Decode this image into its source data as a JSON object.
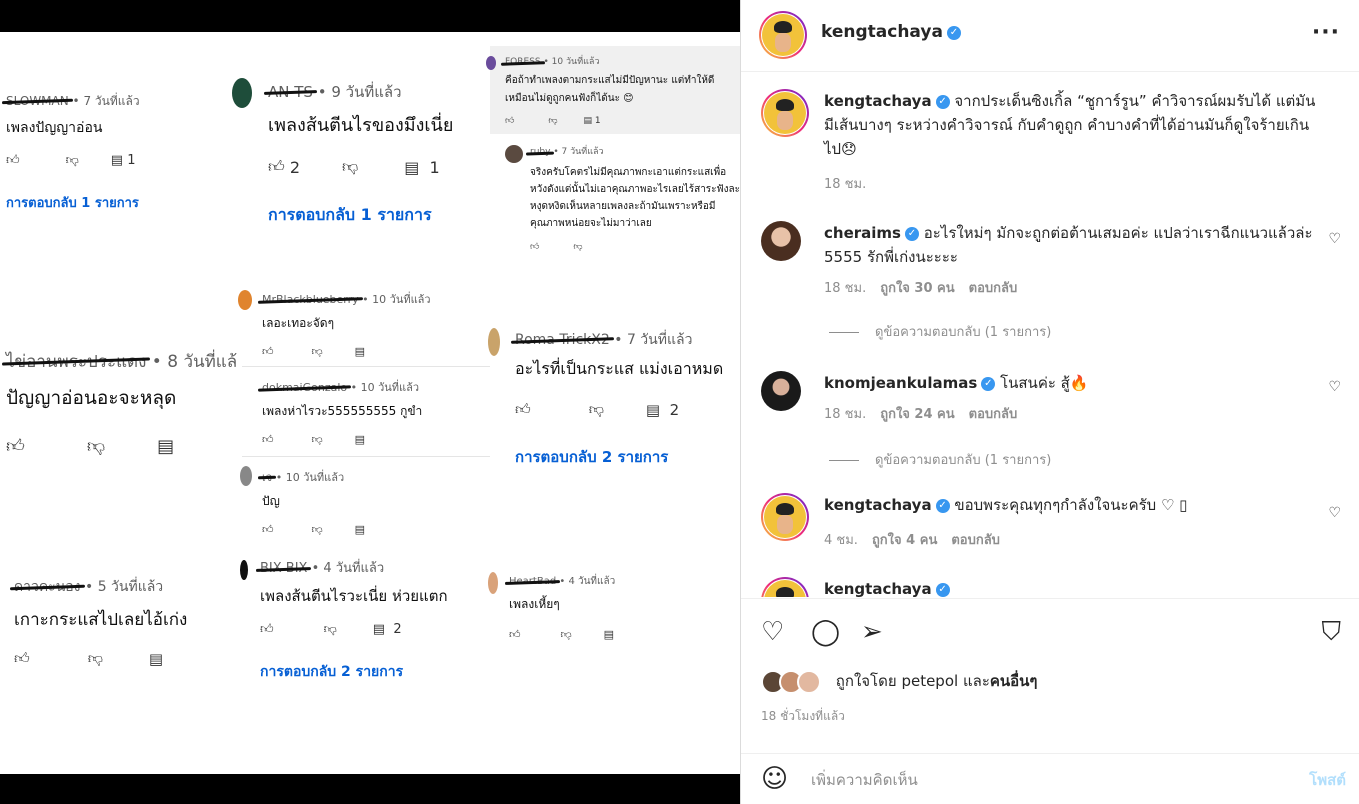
{
  "left": {
    "col1": [
      {
        "name": "SLOWMAN",
        "time": "7 วันที่แล้ว",
        "text": "เพลงปัญญาอ่อน",
        "reply_count": "1",
        "replies": "การตอบกลับ 1 รายการ"
      },
      {
        "name": "ไข่อานพระประแดง",
        "time": "8 วันที่แล้",
        "text": "ปัญญาอ่อนอะจะหลุด"
      },
      {
        "name": "ดาวคะนอง",
        "time": "5 วันที่แล้ว",
        "text": "เกาะกระแสไปเลยไอ้เก่ง"
      }
    ],
    "col2": [
      {
        "name": "AN TS",
        "time": "9 วันที่แล้ว",
        "text": "เพลงส้นตีนไรของมึงเนี่ย",
        "like_count": "2",
        "reply_count": "1",
        "replies": "การตอบกลับ 1 รายการ"
      },
      {
        "name": "MrBlackblueberry",
        "time": "10 วันที่แล้ว",
        "text": "เลอะเทอะจัดๆ"
      },
      {
        "name": "dokmaiGonzalo",
        "time": "10 วันที่แล้ว",
        "text": "เพลงห่าไรวะ555555555 กูขำ"
      },
      {
        "name": "เจ",
        "time": "10 วันที่แล้ว",
        "text": "ปัญ"
      },
      {
        "name": "BIX BIX",
        "time": "4 วันที่แล้ว",
        "text": "เพลงส้นตีนไรวะเนี่ย ห่วยแตก",
        "reply_count": "2",
        "replies": "การตอบกลับ 2 รายการ"
      }
    ],
    "col3": [
      {
        "name": "FORESS",
        "time": "10 วันที่แล้ว",
        "text1": "คือถ้าทำเพลงตามกระแสไม่มีปัญหานะ แต่ทำให้ดี",
        "text2": "เหมือนไม่ดูถูกคนฟังก็ได้นะ 😊",
        "reply_count": "1"
      },
      {
        "name": "ruby",
        "time": "7 วันที่แล้ว",
        "lines": [
          "จริงครับโคตรไม่มีคุณภาพกะเอาแต่กระแสเพื่อ",
          "หวังดังแต่นั้นไม่เอาคุณภาพอะไรเลยไร้สาระฟังละ",
          "หงุดหงิดเห็นหลายเพลงละถ้ามันเพราะหรือมี",
          "คุณภาพหน่อยจะไม่มาว่าเลย"
        ]
      },
      {
        "name": "Roma TrickX2",
        "time": "7 วันที่แล้ว",
        "text": "อะไรที่เป็นกระแส แม่งเอาหมด",
        "reply_count": "2",
        "replies": "การตอบกลับ 2 รายการ"
      },
      {
        "name": "HeartBad",
        "time": "4 วันที่แล้ว",
        "text": "เพลงเหี้ยๆ"
      }
    ]
  },
  "instagram": {
    "header_user": "kengtachaya",
    "more_icon": "more-horizontal-icon",
    "comments": [
      {
        "user": "kengtachaya",
        "text": "จากประเด็นซิงเกิ้ล “ชูการ์รูน” คำวิจารณ์ผมรับได้ แต่มันมีเส้นบางๆ ระหว่างคำวิจารณ์ กับคำดูถูก คำบางคำที่ได้อ่านมันก็ดูใจร้ายเกินไป😞",
        "time": "18 ชม."
      },
      {
        "user": "cheraims",
        "text": "อะไรใหม่ๆ มักจะถูกต่อต้านเสมอค่ะ แปลว่าเราฉีกแนวแล้วล่ะ 5555 รักพี่เก่งนะะะะ",
        "time": "18 ชม.",
        "likes": "ถูกใจ 30 คน",
        "reply": "ตอบกลับ",
        "view_replies": "ดูข้อความตอบกลับ (1 รายการ)"
      },
      {
        "user": "knomjeankulamas",
        "text": "โนสนค่ะ สู้🔥",
        "time": "18 ชม.",
        "likes": "ถูกใจ 24 คน",
        "reply": "ตอบกลับ",
        "view_replies": "ดูข้อความตอบกลับ (1 รายการ)"
      },
      {
        "user": "kengtachaya",
        "text": "ขอบพระคุณทุกๆกำลังใจนะครับ ♡ ▯",
        "time": "4 ชม.",
        "likes": "ถูกใจ 4 คน",
        "reply": "ตอบกลับ"
      },
      {
        "user": "kengtachaya",
        "text": ""
      }
    ],
    "liked_by_prefix": "ถูกใจโดย",
    "liked_by_user": "petepol",
    "liked_by_and": "และ",
    "liked_by_others": "คนอื่นๆ",
    "post_time": "18 ชั่วโมงที่แล้ว",
    "comment_placeholder": "เพิ่มความคิดเห็น",
    "post_button": "โพสต์"
  },
  "colors": {
    "link_blue": "#065fd4",
    "ig_verified": "#3897f0",
    "ig_post_disabled": "#b2dffc"
  }
}
